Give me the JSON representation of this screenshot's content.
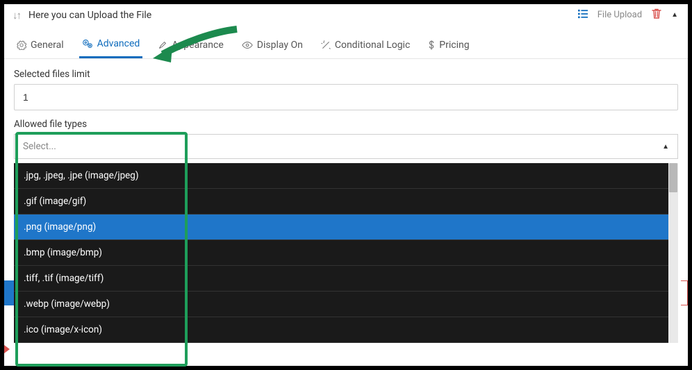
{
  "topbar": {
    "title": "Here you can Upload the File",
    "type_label": "File Upload"
  },
  "tabs": [
    {
      "label": "General"
    },
    {
      "label": "Advanced"
    },
    {
      "label": "Appearance"
    },
    {
      "label": "Display On"
    },
    {
      "label": "Conditional Logic"
    },
    {
      "label": "Pricing"
    }
  ],
  "files_limit": {
    "label": "Selected files limit",
    "value": "1"
  },
  "allowed_types": {
    "label": "Allowed file types",
    "placeholder": "Select...",
    "options": [
      ".jpg, .jpeg, .jpe (image/jpeg)",
      ".gif (image/gif)",
      ".png (image/png)",
      ".bmp (image/bmp)",
      ".tiff, .tif (image/tiff)",
      ".webp (image/webp)",
      ".ico (image/x-icon)"
    ],
    "hovered_index": 2
  }
}
